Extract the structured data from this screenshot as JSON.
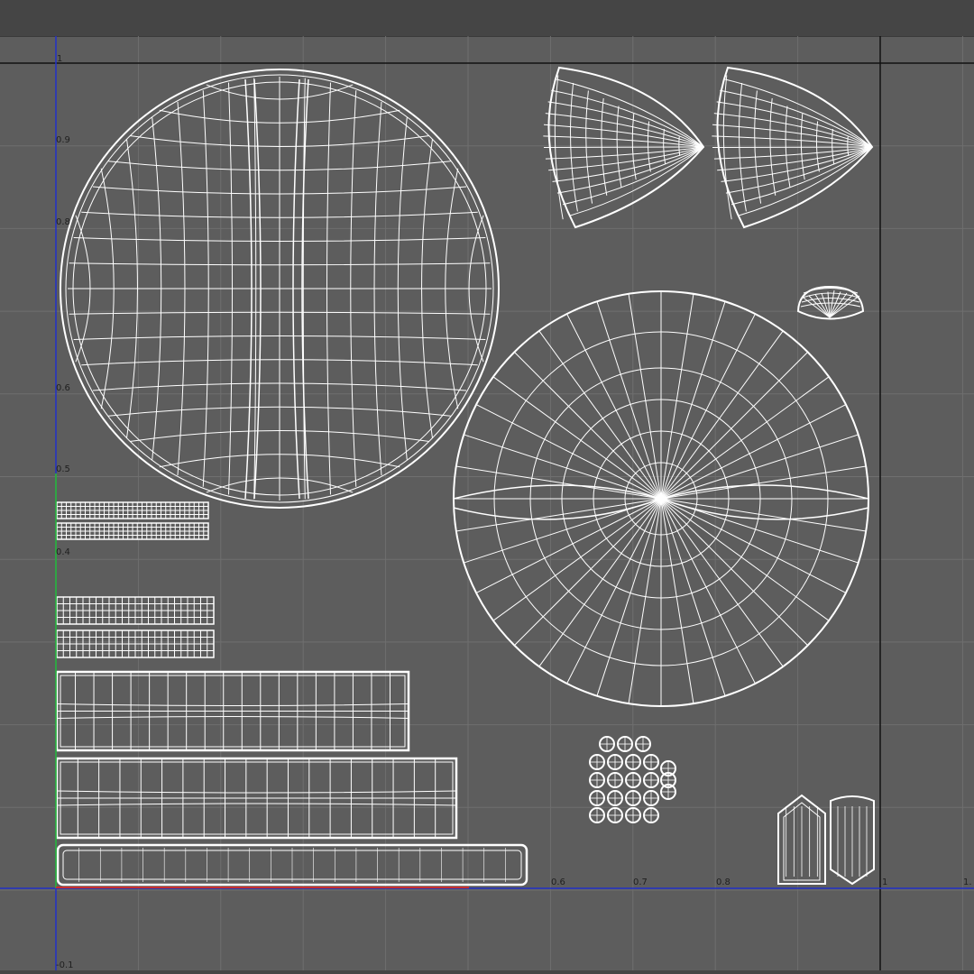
{
  "app": {
    "editor": "UV Editor"
  },
  "colors": {
    "background": "#5d5d5d",
    "grid": "#6f6f6f",
    "gridLight": "#777777",
    "border": "#111111",
    "uAxis": "#2230c8",
    "vAxis": "#2bc42b",
    "uvLines": "#ffffff",
    "selection": "#c83030"
  },
  "axis": {
    "u_ticks": [
      "0.6",
      "0.7",
      "0.8",
      "1",
      "1."
    ],
    "v_ticks": [
      "1",
      "0.9",
      "0.8",
      "0.6",
      "0.5",
      "0.4",
      "-0.1"
    ]
  },
  "uv_islands": [
    {
      "name": "large-disc",
      "shape": "circle"
    },
    {
      "name": "fan-1",
      "shape": "fan"
    },
    {
      "name": "fan-2",
      "shape": "fan"
    },
    {
      "name": "small-dome",
      "shape": "dome"
    },
    {
      "name": "radial-disc",
      "shape": "circle"
    },
    {
      "name": "strip-1",
      "shape": "strip"
    },
    {
      "name": "strip-2",
      "shape": "strip"
    },
    {
      "name": "strip-3",
      "shape": "strip"
    },
    {
      "name": "strip-4",
      "shape": "strip"
    },
    {
      "name": "panel-1",
      "shape": "panel"
    },
    {
      "name": "panel-2",
      "shape": "panel"
    },
    {
      "name": "bar-bottom",
      "shape": "bar"
    },
    {
      "name": "dot-cluster",
      "shape": "dots"
    },
    {
      "name": "crystal-1",
      "shape": "crystal"
    },
    {
      "name": "crystal-2",
      "shape": "crystal"
    }
  ]
}
